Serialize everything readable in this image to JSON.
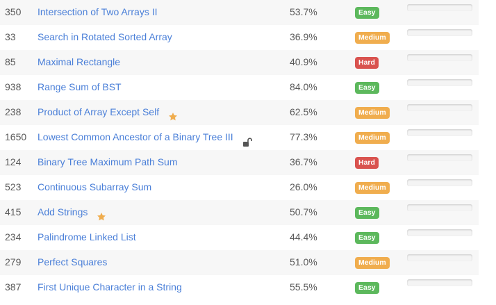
{
  "colors": {
    "link": "#4a7fd8",
    "easy": "#5cb85c",
    "medium": "#f0ad4e",
    "hard": "#d9534f",
    "star": "#f0ad4e"
  },
  "problems": [
    {
      "id": "350",
      "title": "Intersection of Two Arrays II",
      "acceptance": "53.7%",
      "difficulty": "Easy",
      "icon": null,
      "progress": 0
    },
    {
      "id": "33",
      "title": "Search in Rotated Sorted Array",
      "acceptance": "36.9%",
      "difficulty": "Medium",
      "icon": null,
      "progress": 0
    },
    {
      "id": "85",
      "title": "Maximal Rectangle",
      "acceptance": "40.9%",
      "difficulty": "Hard",
      "icon": null,
      "progress": 0
    },
    {
      "id": "938",
      "title": "Range Sum of BST",
      "acceptance": "84.0%",
      "difficulty": "Easy",
      "icon": null,
      "progress": 0
    },
    {
      "id": "238",
      "title": "Product of Array Except Self",
      "acceptance": "62.5%",
      "difficulty": "Medium",
      "icon": "star-icon",
      "progress": 0
    },
    {
      "id": "1650",
      "title": "Lowest Common Ancestor of a Binary Tree III",
      "acceptance": "77.3%",
      "difficulty": "Medium",
      "icon": "lock-icon",
      "progress": 0
    },
    {
      "id": "124",
      "title": "Binary Tree Maximum Path Sum",
      "acceptance": "36.7%",
      "difficulty": "Hard",
      "icon": null,
      "progress": 0
    },
    {
      "id": "523",
      "title": "Continuous Subarray Sum",
      "acceptance": "26.0%",
      "difficulty": "Medium",
      "icon": null,
      "progress": 0
    },
    {
      "id": "415",
      "title": "Add Strings",
      "acceptance": "50.7%",
      "difficulty": "Easy",
      "icon": "star-icon",
      "progress": 0
    },
    {
      "id": "234",
      "title": "Palindrome Linked List",
      "acceptance": "44.4%",
      "difficulty": "Easy",
      "icon": null,
      "progress": 0
    },
    {
      "id": "279",
      "title": "Perfect Squares",
      "acceptance": "51.0%",
      "difficulty": "Medium",
      "icon": null,
      "progress": 0
    },
    {
      "id": "387",
      "title": "First Unique Character in a String",
      "acceptance": "55.5%",
      "difficulty": "Easy",
      "icon": null,
      "progress": 0
    }
  ]
}
